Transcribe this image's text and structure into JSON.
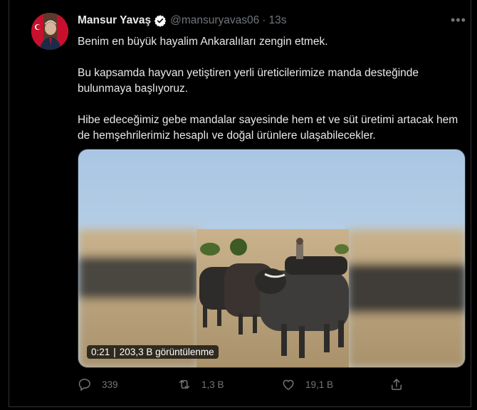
{
  "tweet": {
    "author_name": "Mansur Yavaş",
    "handle": "@mansuryavas06",
    "separator": "·",
    "time": "13s",
    "paragraphs": [
      "Benim en büyük hayalim Ankaralıları zengin etmek.",
      "Bu kapsamda hayvan yetiştiren yerli üreticilerimize manda desteğinde bulunmaya başlıyoruz.",
      "Hibe edeceğimiz gebe mandalar sayesinde hem et ve süt üretimi artacak hem de hemşehrilerimiz hesaplı ve doğal ürünlere ulaşabilecekler."
    ]
  },
  "video": {
    "duration": "0:21",
    "views": "203,3 B görüntülenme"
  },
  "actions": {
    "reply_count": "339",
    "retweet_count": "1,3 B",
    "like_count": "19,1 B"
  },
  "icons": [
    "verified-icon",
    "more-icon",
    "reply-icon",
    "retweet-icon",
    "like-icon",
    "share-icon"
  ],
  "colors": {
    "background": "#000000",
    "text": "#e7e9ea",
    "muted": "#71767b",
    "verified_badge": "#ffffff"
  }
}
